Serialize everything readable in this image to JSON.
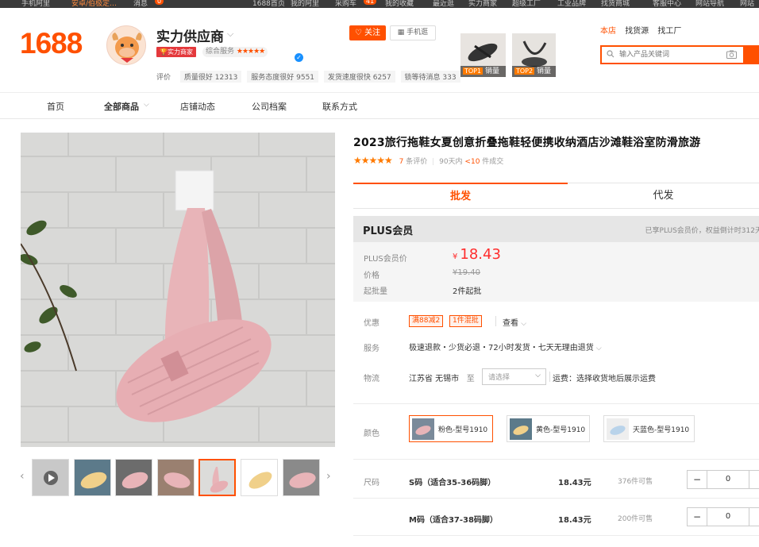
{
  "topbar": {
    "items": [
      "手机阿里",
      "安卓/伯极定…",
      "消息",
      "1688首页",
      "我的阿里",
      "采购车",
      "我的收藏",
      "最近逛",
      "实力商家",
      "超级工厂",
      "工业品牌",
      "找货商城",
      "客服中心",
      "网站导航",
      "网站"
    ],
    "badge_count": "41",
    "msg_badge": "0"
  },
  "header": {
    "logo": "1688",
    "shop_name": "实力供应商",
    "badge_strong": "实力商家",
    "service_label": "综合服务",
    "service_stars": "★★★★★",
    "follow_label": "关注",
    "mobile_label": "手机逛",
    "top_products": [
      {
        "rank": "TOP1",
        "label": "销量"
      },
      {
        "rank": "TOP2",
        "label": "销量"
      }
    ],
    "ratings_label": "评价",
    "ratings": [
      "质量很好 12313",
      "服务态度很好 9551",
      "发货速度很快 6257",
      "锁等待消息 333"
    ],
    "search_tabs": [
      "本店",
      "找货源",
      "找工厂"
    ],
    "search_placeholder": "输入产品关键词"
  },
  "nav": {
    "items": [
      "首页",
      "全部商品",
      "店铺动态",
      "公司档案",
      "联系方式"
    ]
  },
  "product": {
    "title": "2023旅行拖鞋女夏创意折叠拖鞋轻便携收纳酒店沙滩鞋浴室防滑旅游",
    "stars": "★★★★★",
    "review_count": "7",
    "review_suffix": "条评价",
    "sales_prefix": "90天内",
    "sales_value": "<10",
    "sales_suffix": "件成交"
  },
  "tabs": {
    "wholesale": "批发",
    "dropship": "代发"
  },
  "plus": {
    "title": "PLUS会员",
    "note": "已享PLUS会员价，权益倒计时312天",
    "price_label": "PLUS会员价",
    "currency": "¥",
    "price": "18.43",
    "orig_label": "价格",
    "orig_price": "¥19.40",
    "moq_label": "起批量",
    "moq": "2件起批"
  },
  "offers": {
    "label": "优惠",
    "coupons": [
      "满88减2",
      "1件混批"
    ],
    "view_label": "查看"
  },
  "service": {
    "label": "服务",
    "text": "极速退款・少货必退・72小时发货・七天无理由退货"
  },
  "logistics": {
    "label": "物流",
    "from": "江苏省 无锡市",
    "to_label": "至",
    "select_placeholder": "请选择",
    "fee_text": "运费：选择收货地后展示运费"
  },
  "color": {
    "label": "颜色",
    "options": [
      "粉色-型号1910",
      "黄色-型号1910",
      "天蓝色-型号1910"
    ]
  },
  "size": {
    "label": "尺码",
    "rows": [
      {
        "name": "S码（适合35-36码脚）",
        "price": "18.43元",
        "stock": "376件可售",
        "qty": "0"
      },
      {
        "name": "M码（适合37-38码脚）",
        "price": "18.43元",
        "stock": "200件可售",
        "qty": "0"
      }
    ]
  },
  "colors": {
    "accent": "#ff5000",
    "price_red": "#ff2d2d",
    "slipper_pink": "#e8b4b8",
    "slipper_yellow": "#f0d08a"
  }
}
